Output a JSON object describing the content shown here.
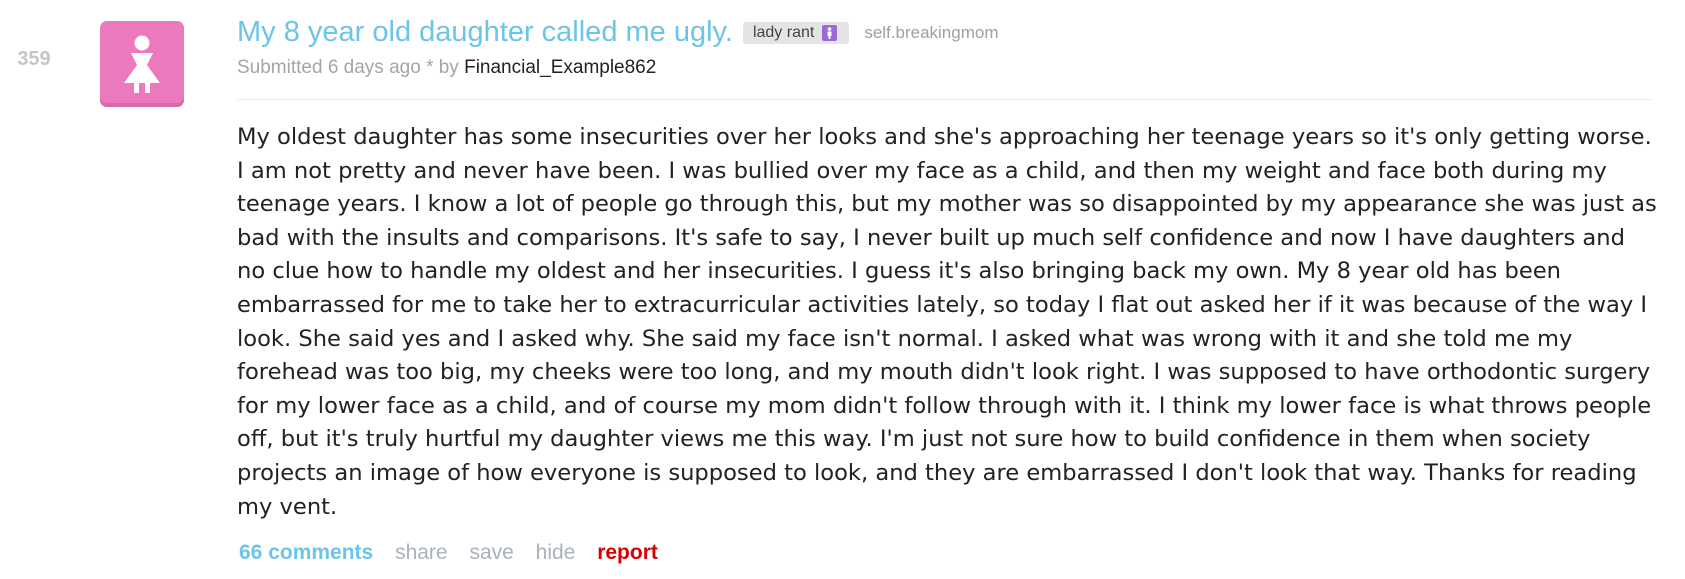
{
  "post": {
    "score": "359",
    "thumbnail_icon": "woman-figure-icon",
    "title": "My 8 year old daughter called me ugly.",
    "flair": {
      "label": "lady rant",
      "icon": "woman-figure-icon"
    },
    "domain": "self.breakingmom",
    "tagline": {
      "prefix": "Submitted 6 days ago * by ",
      "author": "Financial_Example862"
    },
    "body": "My oldest daughter has some insecurities over her looks and she's approaching her teenage years so it's only getting worse. I am not pretty and never have been. I was bullied over my face as a child, and then my weight and face both during my teenage years. I know a lot of people go through this, but my mother was so disappointed by my appearance she was just as bad with the insults and comparisons. It's safe to say, I never built up much self confidence and now I have daughters and no clue how to handle my oldest and her insecurities. I guess it's also bringing back my own. My 8 year old has been embarrassed for me to take her to extracurricular activities lately, so today I flat out asked her if it was because of the way I look. She said yes and I asked why. She said my face isn't normal. I asked what was wrong with it and she told me my forehead was too big, my cheeks were too long, and my mouth didn't look right. I was supposed to have orthodontic surgery for my lower face as a child, and of course my mom didn't follow through with it. I think my lower face is what throws people off, but it's truly hurtful my daughter views me this way. I'm just not sure how to build confidence in them when society projects an image of how everyone is supposed to look, and they are embarrassed I don't look that way. Thanks for reading my vent.",
    "actions": {
      "comments": "66 comments",
      "share": "share",
      "save": "save",
      "hide": "hide",
      "report": "report"
    }
  },
  "colors": {
    "title": "#6cc4e8",
    "thumbnail": "#ec79bd",
    "flair_icon": "#9a6bd3",
    "report": "#d60000"
  }
}
